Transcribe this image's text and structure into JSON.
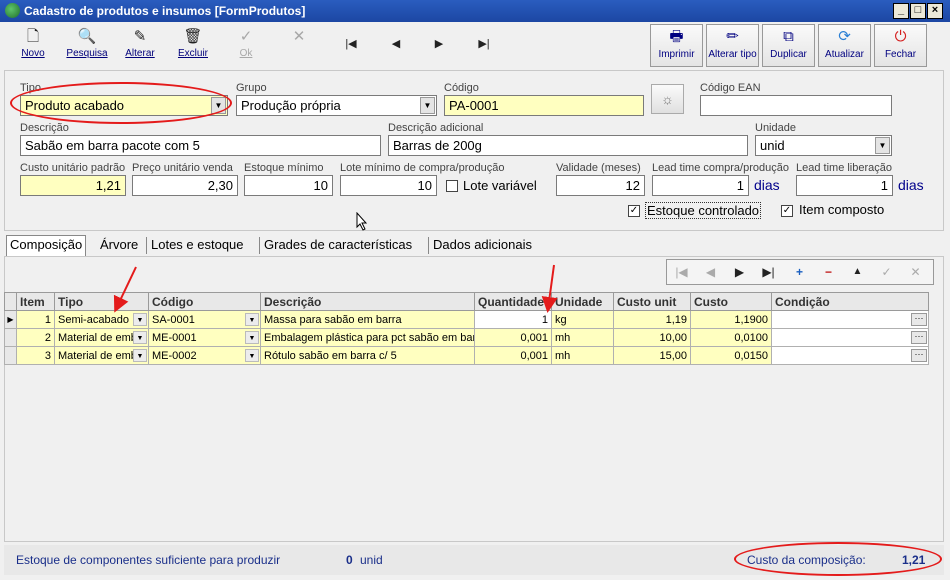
{
  "window": {
    "title": "Cadastro de produtos e insumos [FormProdutos]"
  },
  "toolbar": {
    "left": [
      {
        "label": "Novo",
        "icon": "new-document-icon"
      },
      {
        "label": "Pesquisa",
        "icon": "magnifier-icon"
      },
      {
        "label": "Alterar",
        "icon": "edit-document-icon"
      },
      {
        "label": "Excluir",
        "icon": "trash-icon"
      },
      {
        "label": "Ok",
        "icon": "check-icon"
      }
    ],
    "right": [
      {
        "label": "Imprimir",
        "icon": "printer-icon"
      },
      {
        "label": "Alterar tipo",
        "icon": "pencil-icon"
      },
      {
        "label": "Duplicar",
        "icon": "copy-icon"
      },
      {
        "label": "Atualizar",
        "icon": "refresh-icon"
      },
      {
        "label": "Fechar",
        "icon": "power-icon"
      }
    ]
  },
  "form": {
    "tipo_label": "Tipo",
    "tipo_value": "Produto acabado",
    "grupo_label": "Grupo",
    "grupo_value": "Produção própria",
    "codigo_label": "Código",
    "codigo_value": "PA-0001",
    "ean_label": "Código EAN",
    "ean_value": "",
    "descricao_label": "Descrição",
    "descricao_value": "Sabão em barra pacote com 5",
    "desc_adic_label": "Descrição adicional",
    "desc_adic_value": "Barras de 200g",
    "unidade_label": "Unidade",
    "unidade_value": "unid",
    "custo_label": "Custo unitário padrão",
    "custo_value": "1,21",
    "preco_label": "Preço unitário venda",
    "preco_value": "2,30",
    "estmin_label": "Estoque mínimo",
    "estmin_value": "10",
    "lotemin_label": "Lote mínimo de compra/produção",
    "lotemin_value": "10",
    "lotevar_label": "Lote variável",
    "lotevar_checked": false,
    "validade_label": "Validade (meses)",
    "validade_value": "12",
    "leadcompra_label": "Lead time compra/produção",
    "leadcompra_value": "1",
    "leadlib_label": "Lead time liberação",
    "leadlib_value": "1",
    "dias": "dias",
    "estctrl_label": "Estoque controlado",
    "estctrl_checked": true,
    "itemcomp_label": "Item composto",
    "itemcomp_checked": true
  },
  "tabs": [
    "Composição",
    "Árvore",
    "Lotes e estoque",
    "Grades de características",
    "Dados adicionais"
  ],
  "grid": {
    "columns": [
      "Item",
      "Tipo",
      "Código",
      "Descrição",
      "Quantidade",
      "Unidade",
      "Custo unit",
      "Custo",
      "Condição"
    ],
    "rows": [
      {
        "item": "1",
        "tipo": "Semi-acabado",
        "codigo": "SA-0001",
        "descricao": "Massa para sabão em barra",
        "quantidade": "1",
        "unidade": "kg",
        "custo_unit": "1,19",
        "custo": "1,1900",
        "condicao": ""
      },
      {
        "item": "2",
        "tipo": "Material de emb",
        "codigo": "ME-0001",
        "descricao": "Embalagem plástica para pct sabão em barra",
        "quantidade": "0,001",
        "unidade": "mh",
        "custo_unit": "10,00",
        "custo": "0,0100",
        "condicao": ""
      },
      {
        "item": "3",
        "tipo": "Material de emb",
        "codigo": "ME-0002",
        "descricao": "Rótulo sabão em barra c/ 5",
        "quantidade": "0,001",
        "unidade": "mh",
        "custo_unit": "15,00",
        "custo": "0,0150",
        "condicao": ""
      }
    ]
  },
  "status": {
    "estoque_text": "Estoque de componentes suficiente para produzir",
    "estoque_value": "0",
    "estoque_unit": "unid",
    "custo_comp_label": "Custo da composição:",
    "custo_comp_value": "1,21"
  },
  "colors": {
    "highlight": "#e41b1b",
    "field_yellow": "#ffffc0",
    "titlebar": "#1c47a3"
  }
}
